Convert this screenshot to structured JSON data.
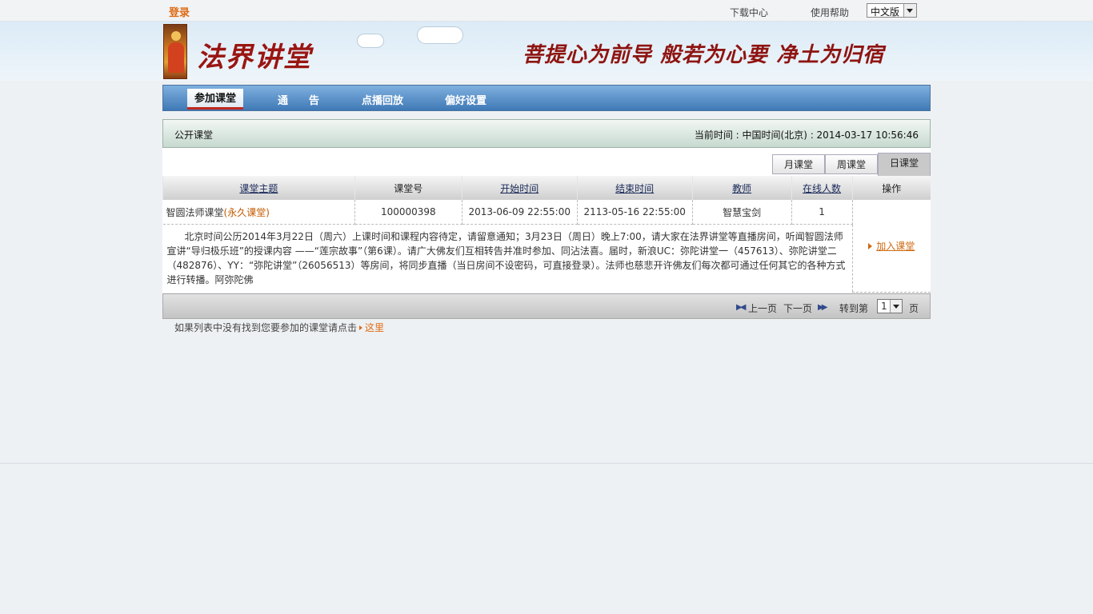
{
  "topbar": {
    "login": "登录",
    "download": "下载中心",
    "help": "使用帮助",
    "language": "中文版"
  },
  "banner": {
    "title": "法界讲堂",
    "slogan": "菩提心为前导  般若为心要  净土为归宿"
  },
  "nav": {
    "items": [
      "参加课堂",
      "通　　告",
      "点播回放",
      "偏好设置"
    ]
  },
  "panel": {
    "title": "公开课堂",
    "time": "当前时间 : 中国时间(北京) : 2014-03-17 10:56:46"
  },
  "tabs": [
    "月课堂",
    "周课堂",
    "日课堂"
  ],
  "table": {
    "headers": [
      "课堂主题",
      "课堂号",
      "开始时间",
      "结束时间",
      "教师",
      "在线人数",
      "操作"
    ],
    "rows": [
      {
        "topic": "智圆法师课堂",
        "topic_tag": "(永久课堂)",
        "id": "100000398",
        "start": "2013-06-09 22:55:00",
        "end": "2113-05-16 22:55:00",
        "teacher": "智慧宝剑",
        "online": "1",
        "action": "加入课堂",
        "description": "北京时间公历2014年3月22日（周六）上课时间和课程内容待定，请留意通知；3月23日（周日）晚上7:00，请大家在法界讲堂等直播房间，听闻智圆法师宣讲“导归极乐班”的授课内容 ——“莲宗故事”（第6课）。请广大佛友们互相转告并准时参加、同沾法喜。届时，新浪UC：弥陀讲堂一（457613）、弥陀讲堂二（482876）、YY：“弥陀讲堂”（26056513）等房间，将同步直播（当日房间不设密码，可直接登录）。法师也慈悲开许佛友们每次都可通过任何其它的各种方式进行转播。阿弥陀佛"
      }
    ]
  },
  "pager": {
    "prev": "上一页",
    "next": "下一页",
    "goto": "转到第",
    "page": "1",
    "unit": "页"
  },
  "note": {
    "text": "如果列表中没有找到您要参加的课堂请点击",
    "link": "这里"
  }
}
